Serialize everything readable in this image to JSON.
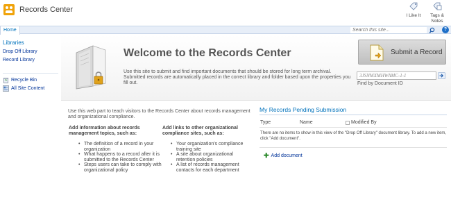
{
  "header": {
    "site_title": "Records Center",
    "like_label": "I Like It",
    "tags_label_1": "Tags &",
    "tags_label_2": "Notes"
  },
  "topnav": {
    "home_tab": "Home",
    "search_placeholder": "Search this site...",
    "help_glyph": "?"
  },
  "leftnav": {
    "heading": "Libraries",
    "items": [
      "Drop Off Library",
      "Record Library"
    ],
    "recycle_bin": "Recycle Bin",
    "all_site_content": "All Site Content"
  },
  "welcome": {
    "title": "Welcome to the Records Center",
    "description": "Use this site to submit and find important documents that should be stored for long term archival. Submitted records are automatically placed in the correct library and folder based upon the properties you fill out.",
    "submit_label": "Submit a Record",
    "docid_value": "3JSNMXMHWAMC-1-1",
    "docid_label": "Find by Document ID"
  },
  "webpart": {
    "intro": "Use this web part to teach visitors to the Records Center about records management and organizational compliance.",
    "col1_heading": "Add information about records management topics, such as:",
    "col1_items": [
      "The definition of a record in your organization",
      "What happens to a record after it is submitted to the Records Center",
      "Steps users can take to comply with organizational policy"
    ],
    "col2_heading": "Add links to other organizational compliance sites, such as:",
    "col2_items": [
      "Your organization's compliance training site",
      "A site about organizational retention policies",
      "A list of records management contacts for each department"
    ]
  },
  "pending": {
    "title": "My Records Pending Submission",
    "columns": [
      "Type",
      "Name",
      "Modified By"
    ],
    "empty_message": "There are no items to show in this view of the \"Drop Off Library\" document library. To add a new item, click \"Add document\".",
    "add_label": "Add document"
  },
  "colors": {
    "link_blue": "#0072bc",
    "nav_bg": "#e7eef8",
    "logo_orange": "#f0a30a"
  }
}
